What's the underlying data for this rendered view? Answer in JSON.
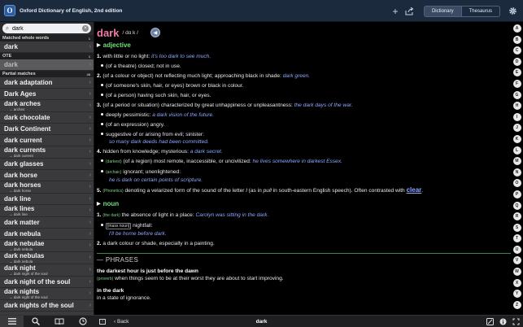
{
  "app": {
    "title": "Oxford Dictionary of English, 2nd edition",
    "icon_letter": "O"
  },
  "top_tabs": [
    {
      "label": "Dictionary",
      "active": true
    },
    {
      "label": "Thesaurus",
      "active": false
    }
  ],
  "search": {
    "value": "dark",
    "placeholder": ""
  },
  "sidebar": {
    "matched_header": "Matched whole words",
    "matched_count": "1",
    "matched_items": [
      "dark"
    ],
    "ote_header": "OTE",
    "ote_count": "1",
    "ote_items": [
      "dark"
    ],
    "partial_header": "Partial matches",
    "partial_count": "48",
    "partial_items": [
      {
        "label": "dark adaptation",
        "sub": ""
      },
      {
        "label": "Dark Ages",
        "sub": ""
      },
      {
        "label": "dark arches",
        "sub": "→ arches"
      },
      {
        "label": "dark chocolate",
        "sub": ""
      },
      {
        "label": "Dark Continent",
        "sub": ""
      },
      {
        "label": "dark current",
        "sub": ""
      },
      {
        "label": "dark currents",
        "sub": "→ dark current"
      },
      {
        "label": "dark glasses",
        "sub": ""
      },
      {
        "label": "dark horse",
        "sub": ""
      },
      {
        "label": "dark horses",
        "sub": "→ dark horse"
      },
      {
        "label": "dark line",
        "sub": ""
      },
      {
        "label": "dark lines",
        "sub": "→ dark line"
      },
      {
        "label": "dark matter",
        "sub": ""
      },
      {
        "label": "dark nebula",
        "sub": ""
      },
      {
        "label": "dark nebulae",
        "sub": "→ dark nebula"
      },
      {
        "label": "dark nebulas",
        "sub": "→ dark nebula"
      },
      {
        "label": "dark night",
        "sub": "→ dark night of the soul"
      },
      {
        "label": "dark night of the soul",
        "sub": ""
      },
      {
        "label": "dark nights",
        "sub": "→ dark night of the soul"
      },
      {
        "label": "dark nights of the soul",
        "sub": ""
      }
    ]
  },
  "entry": {
    "headword": "dark",
    "pron": "/ dɑːk /",
    "speaker_icon": "speaker-icon",
    "pos_adjective": "adjective",
    "pos_noun": "noun",
    "s1_def": "with little or no light:",
    "s1_ex": "it's too dark to see much.",
    "s1a": "(of a theatre) closed; not in use.",
    "s2_def": "(of a colour or object) not reflecting much light; approaching black in shade:",
    "s2_ex": "dark green.",
    "s2a": "(of someone's skin, hair, or eyes) brown or black in colour.",
    "s2b": "(of a person) having such skin, hair, or eyes.",
    "s3_def": "(of a period or situation) characterized by great unhappiness or unpleasantness:",
    "s3_ex": "the dark days of the war.",
    "s3a_def": "deeply pessimistic:",
    "s3a_ex": "a dark vision of the future.",
    "s3b": "(of an expression) angry.",
    "s3c_def": "suggestive of or arising from evil; sinister:",
    "s3c_ex": "so many dark deeds had been committed.",
    "s4_def": "hidden from knowledge; mysterious:",
    "s4_ex": "a dark secret.",
    "s4a_lab": "(darkest)",
    "s4a_def": "(of a region) most remote, inaccessible, or uncivilized:",
    "s4a_ex": "he lives somewhere in darkest Essex.",
    "s4b_lab": "(archaic)",
    "s4b_def": "ignorant; unenlightened:",
    "s4b_ex": "he is dark on certain points of scripture.",
    "s5_lab": "(Phonetics)",
    "s5_def1": "denoting a velarized form of the sound of the letter",
    "s5_l": "l",
    "s5_def2": "(as in",
    "s5_pull": "pull",
    "s5_def3": "in south-eastern English speech). Often contrasted with",
    "s5_link": "clear",
    "s5_end": ".",
    "n1_lab": "(the dark)",
    "n1_def": "the absence of light in a place:",
    "n1_ex": "Carolyn was sitting in the dark.",
    "n1a_lab": "[mass noun]",
    "n1a_def": "nightfall:",
    "n1a_ex": "I'll be home before dark.",
    "n2": "a dark colour or shade, especially in a painting.",
    "phrases_head": "— PHRASES",
    "p1_head": "the darkest hour is just before the dawn",
    "p1_lab": "(proverb)",
    "p1_def": "when things seem to be at their worst they are about to start improving.",
    "p2_head": "in the dark",
    "p2_def": "in a state of ignorance.",
    "num1": "1.",
    "num2": "2.",
    "num3": "3.",
    "num4": "4.",
    "num5": "5."
  },
  "alphabet": [
    "A",
    "B",
    "C",
    "D",
    "E",
    "F",
    "G",
    "H",
    "I",
    "J",
    "K",
    "L",
    "M",
    "N",
    "O",
    "P",
    "Q",
    "R",
    "S",
    "T",
    "U",
    "V",
    "W",
    "X",
    "Y",
    "Z"
  ],
  "bottom": {
    "back_label": "Back",
    "current_word": "dark"
  }
}
